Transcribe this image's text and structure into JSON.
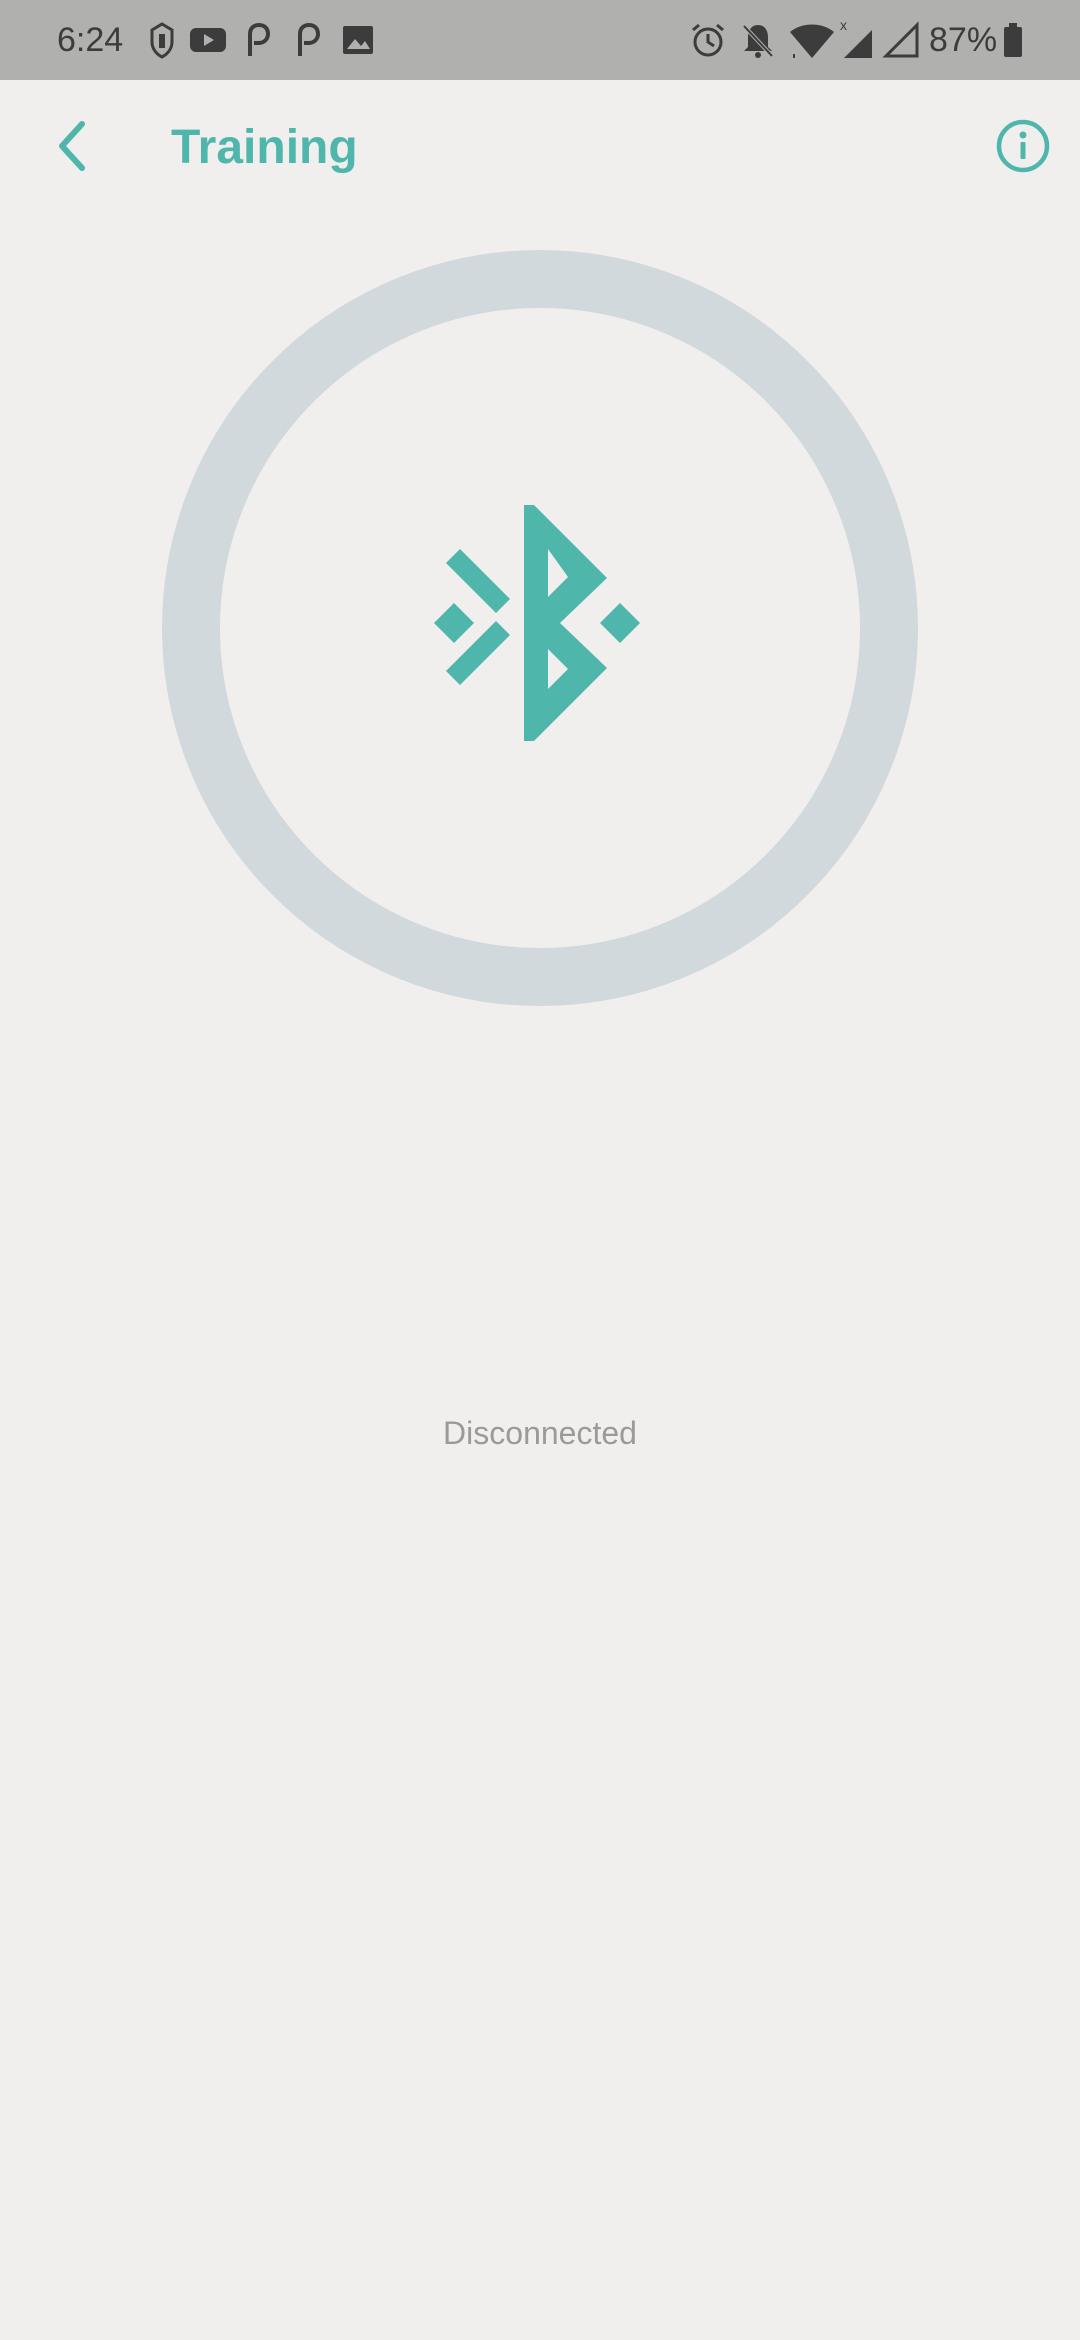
{
  "status_bar": {
    "time": "6:24",
    "battery_percent": "87%",
    "notification_icons": [
      "badge-icon",
      "youtube-icon",
      "p-app-icon",
      "p-app-icon",
      "gallery-icon"
    ],
    "system_icons": [
      "alarm-icon",
      "notifications-off-icon",
      "wifi-icon",
      "cell-signal-icon",
      "cell-signal-empty-icon",
      "battery-icon"
    ]
  },
  "app_bar": {
    "title": "Training",
    "back_icon": "chevron-left-icon",
    "info_icon": "info-icon"
  },
  "connection": {
    "status": "Disconnected",
    "icon": "bluetooth-searching-icon"
  },
  "colors": {
    "accent": "#4fb6ac",
    "ring": "#d2d9dd",
    "background": "#f1efed",
    "status_bar": "#b0b0ae",
    "status_text": "#9a9a9a"
  }
}
